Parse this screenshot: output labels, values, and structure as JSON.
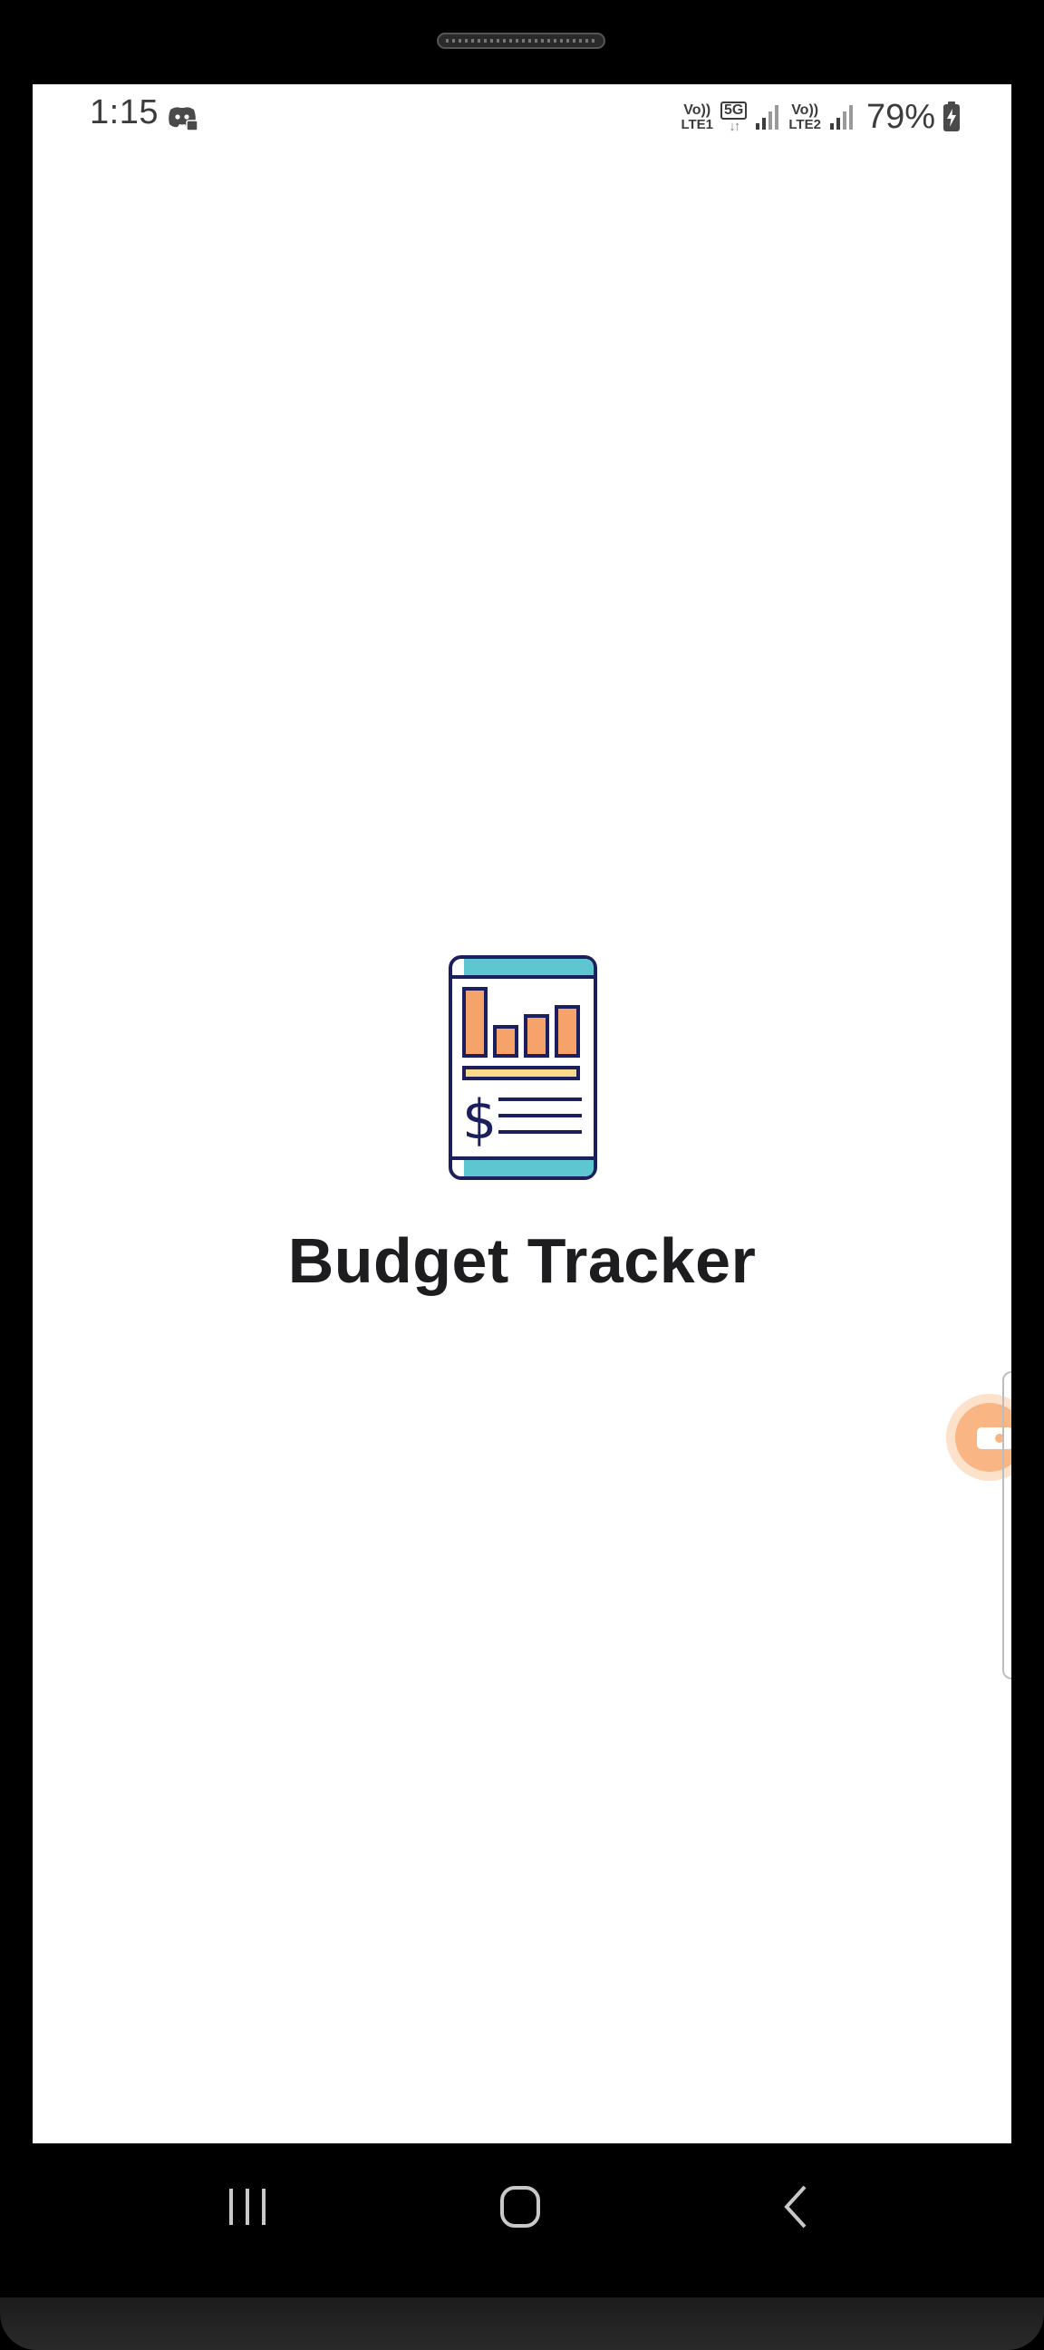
{
  "status_bar": {
    "time": "1:15",
    "left_icon": "discord-notification-icon",
    "sim1_top": "Vo))",
    "sim1_bottom": "LTE1",
    "network_type": "5G",
    "network_arrows": "↓↑",
    "sim2_top": "Vo))",
    "sim2_bottom": "LTE2",
    "battery_percent": "79%",
    "battery_icon": "battery-charging-icon"
  },
  "splash": {
    "logo_icon": "budget-report-phone-icon",
    "app_title": "Budget Tracker"
  },
  "overlay": {
    "floating_button_icon": "screen-record-icon"
  },
  "nav_bar": {
    "recents_icon": "recents-icon",
    "home_icon": "home-icon",
    "back_icon": "back-icon"
  },
  "colors": {
    "logo_teal": "#5ec6d0",
    "logo_orange": "#f6a36b",
    "logo_yellow": "#f8d98a",
    "logo_outline": "#1c1f5e",
    "title_text": "#1d1d20",
    "float_button": "#f9b583"
  }
}
